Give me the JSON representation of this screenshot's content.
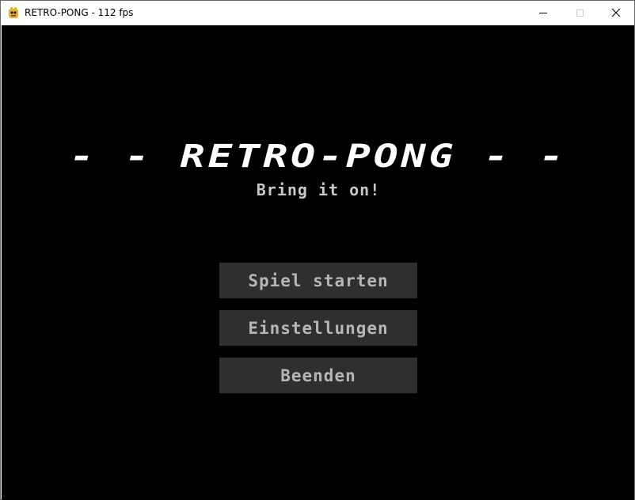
{
  "window": {
    "title": "RETRO-PONG - 112 fps",
    "icon": "pygame-snake-icon"
  },
  "game": {
    "logo": "- - RETRO-PONG - -",
    "tagline": "Bring it on!",
    "menu": [
      {
        "label": "Spiel starten"
      },
      {
        "label": "Einstellungen"
      },
      {
        "label": "Beenden"
      }
    ]
  },
  "colors": {
    "background": "#000000",
    "button_bg": "#2f2f2f",
    "button_text": "#b6b6b6",
    "logo": "#ffffff"
  }
}
